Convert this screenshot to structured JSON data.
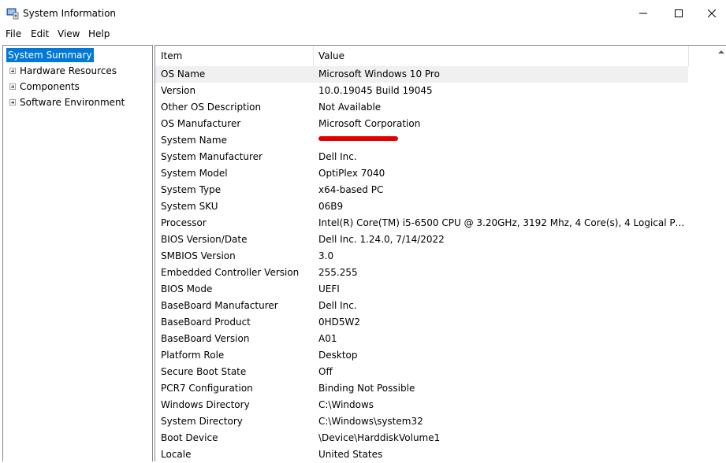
{
  "window": {
    "title": "System Information"
  },
  "menu": [
    "File",
    "Edit",
    "View",
    "Help"
  ],
  "tree": {
    "selected": "System Summary",
    "items": [
      "Hardware Resources",
      "Components",
      "Software Environment"
    ]
  },
  "table": {
    "headers": {
      "item": "Item",
      "value": "Value"
    },
    "rows": [
      {
        "item": "OS Name",
        "value": "Microsoft Windows 10 Pro"
      },
      {
        "item": "Version",
        "value": "10.0.19045 Build 19045"
      },
      {
        "item": "Other OS Description",
        "value": "Not Available"
      },
      {
        "item": "OS Manufacturer",
        "value": "Microsoft Corporation"
      },
      {
        "item": "System Name",
        "value": ""
      },
      {
        "item": "System Manufacturer",
        "value": "Dell Inc."
      },
      {
        "item": "System Model",
        "value": "OptiPlex 7040"
      },
      {
        "item": "System Type",
        "value": "x64-based PC"
      },
      {
        "item": "System SKU",
        "value": "06B9"
      },
      {
        "item": "Processor",
        "value": "Intel(R) Core(TM) i5-6500 CPU @ 3.20GHz, 3192 Mhz, 4 Core(s), 4 Logical Pro..."
      },
      {
        "item": "BIOS Version/Date",
        "value": "Dell Inc. 1.24.0, 7/14/2022"
      },
      {
        "item": "SMBIOS Version",
        "value": "3.0"
      },
      {
        "item": "Embedded Controller Version",
        "value": "255.255"
      },
      {
        "item": "BIOS Mode",
        "value": "UEFI"
      },
      {
        "item": "BaseBoard Manufacturer",
        "value": "Dell Inc."
      },
      {
        "item": "BaseBoard Product",
        "value": "0HD5W2"
      },
      {
        "item": "BaseBoard Version",
        "value": "A01"
      },
      {
        "item": "Platform Role",
        "value": "Desktop"
      },
      {
        "item": "Secure Boot State",
        "value": "Off"
      },
      {
        "item": "PCR7 Configuration",
        "value": "Binding Not Possible"
      },
      {
        "item": "Windows Directory",
        "value": "C:\\Windows"
      },
      {
        "item": "System Directory",
        "value": "C:\\Windows\\system32"
      },
      {
        "item": "Boot Device",
        "value": "\\Device\\HarddiskVolume1"
      },
      {
        "item": "Locale",
        "value": "United States"
      }
    ]
  },
  "colors": {
    "selection": "#0078d7",
    "redaction": "#e00000"
  }
}
